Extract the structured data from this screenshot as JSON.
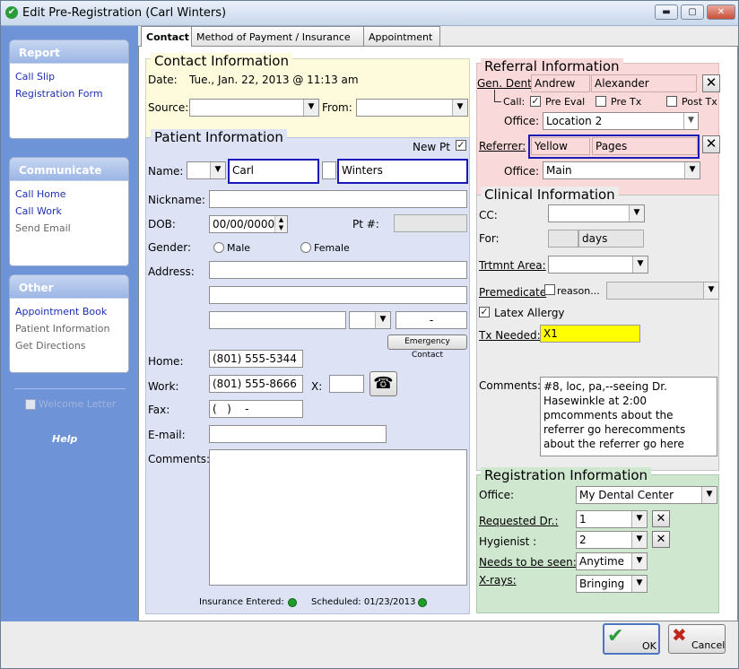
{
  "window": {
    "title": "Edit Pre-Registration (Carl Winters)",
    "min": "▬",
    "max": "▢",
    "close": "✕"
  },
  "sidebar": {
    "report": {
      "header": "Report",
      "items": [
        "Call Slip",
        "Registration Form"
      ]
    },
    "communicate": {
      "header": "Communicate",
      "items": [
        "Call Home",
        "Call Work",
        "Send Email"
      ]
    },
    "other": {
      "header": "Other",
      "items": [
        "Appointment Book",
        "Patient Information",
        "Get Directions"
      ]
    },
    "welcome_letter": "Welcome Letter",
    "help": "Help"
  },
  "tabs": [
    "Contact",
    "Method of Payment / Insurance",
    "Appointment"
  ],
  "contact": {
    "title": "Contact Information",
    "date_label": "Date:",
    "date_value": "Tue., Jan. 22, 2013 @ 11:13 am",
    "source_label": "Source:",
    "from_label": "From:"
  },
  "patient": {
    "title": "Patient Information",
    "new_pt_label": "New Pt",
    "new_pt_checked": true,
    "name_label": "Name:",
    "first_name": "Carl",
    "last_name": "Winters",
    "nickname_label": "Nickname:",
    "dob_label": "DOB:",
    "dob_value": "00/00/0000",
    "pt_num_label": "Pt #:",
    "gender_label": "Gender:",
    "male": "Male",
    "female": "Female",
    "address_label": "Address:",
    "zip_value": "-",
    "emergency_contact": "Emergency Contact",
    "home_label": "Home:",
    "home_value": "(801) 555-5344",
    "work_label": "Work:",
    "work_value": "(801) 555-8666",
    "ext_label": "X:",
    "fax_label": "Fax:",
    "fax_value": "(   )    -",
    "email_label": "E-mail:",
    "comments_label": "Comments:",
    "insurance_entered": "Insurance Entered:",
    "scheduled": "Scheduled: 01/23/2013"
  },
  "referral": {
    "title": "Referral Information",
    "gen_dent_label": "Gen. Dent:",
    "gen_dent_first": "Andrew",
    "gen_dent_last": "Alexander",
    "call_label": "Call:",
    "pre_eval": "Pre Eval",
    "pre_eval_checked": true,
    "pre_tx": "Pre Tx",
    "post_tx": "Post Tx",
    "office_label": "Office:",
    "office1": "Location 2",
    "referrer_label": "Referrer:",
    "referrer_first": "Yellow",
    "referrer_last": "Pages",
    "office2": "Main"
  },
  "clinical": {
    "title": "Clinical Information",
    "cc_label": "CC:",
    "for_label": "For:",
    "days": "days",
    "trtmnt_label": "Trtmnt Area:",
    "premedicate_label": "Premedicate",
    "reason_label": "reason...",
    "latex_label": "Latex Allergy",
    "latex_checked": true,
    "tx_needed_label": "Tx Needed:",
    "tx_needed_value": "X1",
    "comments_label": "Comments:",
    "comments_value": "#8, loc, pa,--seeing Dr. Hasewinkle at 2:00 pmcomments about the referrer go herecomments about the referrer go here"
  },
  "registration": {
    "title": "Registration Information",
    "office_label": "Office:",
    "office_value": "My Dental Center",
    "req_dr_label": "Requested Dr.:",
    "req_dr_value": "1",
    "hygienist_label": "Hygienist :",
    "hygienist_value": "2",
    "needs_label": "Needs to be seen:",
    "needs_value": "Anytime",
    "xrays_label": "X-rays:",
    "xrays_value": "Bringing"
  },
  "buttons": {
    "ok": "OK",
    "cancel": "Cancel"
  },
  "colors": {
    "contact_bg": "#fdfbdc",
    "patient_bg": "#dde3f5",
    "referral_bg": "#f9d9d9",
    "registration_bg": "#cfe6cf",
    "sidebar_bg": "#6e93d6",
    "tx_highlight": "#ffff00"
  }
}
